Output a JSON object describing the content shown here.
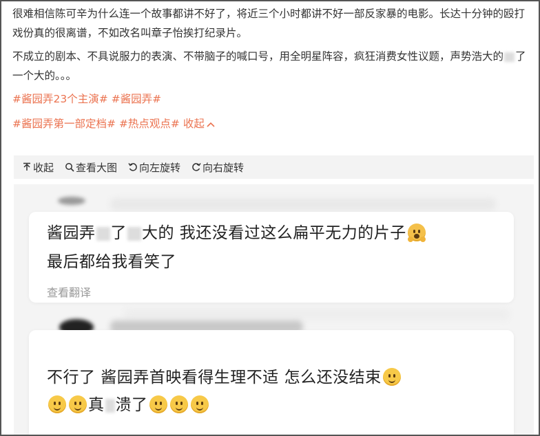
{
  "post": {
    "paragraph1": "很难相信陈可辛为什么连一个故事都讲不好了，将近三个小时都讲不好一部反家暴的电影。长达十分钟的殴打戏份真的很离谱，不如改名叫章子怡挨打纪录片。",
    "paragraph2_part1": "不成立的剧本、不具说服力的表演、不带脑子的喊口号，用全明星阵容，疯狂消费女性议题，声势浩大的",
    "paragraph2_part2": "了一个大的。。。",
    "tags_line1": [
      "#酱园弄23个主演#",
      "#酱园弄#"
    ],
    "tags_line2": [
      "#酱园弄第一部定档#",
      "#热点观点#"
    ],
    "collapse_label": "收起"
  },
  "toolbar": {
    "collapse": "收起",
    "view_large": "查看大图",
    "rotate_left": "向左旋转",
    "rotate_right": "向右旋转"
  },
  "comments": [
    {
      "line1_a": "酱园弄",
      "line1_b": "了",
      "line1_c": "大的 我还没看过这么扁平无力的片子",
      "line2": "最后都给我看笑了",
      "translate": "查看翻译"
    },
    {
      "line1": "不行了 酱园弄首映看得生理不适 怎么还没结束",
      "line2_a": "真",
      "line2_b": "溃了"
    }
  ],
  "colors": {
    "tag": "#eb7350",
    "toolbar_bg": "#f3f3f3",
    "panel_bg": "#f4f4f4"
  }
}
